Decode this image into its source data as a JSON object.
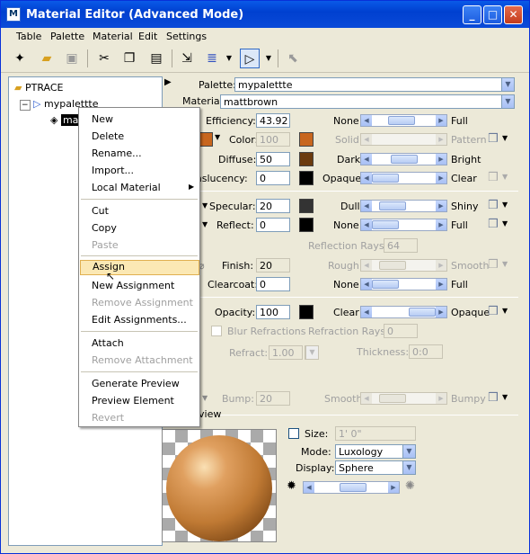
{
  "window": {
    "title": "Material Editor (Advanced Mode)",
    "controls": {
      "minimize": "_",
      "maximize": "□",
      "close": "✕"
    }
  },
  "menubar": [
    "Table",
    "Palette",
    "Material",
    "Edit",
    "Settings"
  ],
  "toolbar": {
    "icons": [
      "new-icon",
      "open-icon",
      "save-icon",
      "cut-icon",
      "copy-icon",
      "paste-icon",
      "import-icon",
      "palette-layers-icon",
      "assign-icon",
      "pick-icon"
    ]
  },
  "tree": {
    "root": "PTRACE",
    "palette": "mypalettte",
    "material": "ma"
  },
  "context_menu": {
    "items": [
      {
        "label": "New",
        "disabled": false
      },
      {
        "label": "Delete",
        "disabled": false
      },
      {
        "label": "Rename...",
        "disabled": false
      },
      {
        "label": "Import...",
        "disabled": false
      },
      {
        "label": "Local Material",
        "disabled": false,
        "submenu": true
      },
      {
        "label": "Cut",
        "disabled": false
      },
      {
        "label": "Copy",
        "disabled": false
      },
      {
        "label": "Paste",
        "disabled": true
      },
      {
        "label": "Assign",
        "disabled": false,
        "highlighted": true
      },
      {
        "label": "New Assignment",
        "disabled": false
      },
      {
        "label": "Remove Assignment",
        "disabled": true
      },
      {
        "label": "Edit Assignments...",
        "disabled": false
      },
      {
        "label": "Attach",
        "disabled": false
      },
      {
        "label": "Remove Attachment",
        "disabled": true
      },
      {
        "label": "Generate Preview",
        "disabled": false
      },
      {
        "label": "Preview Element",
        "disabled": false
      },
      {
        "label": "Revert",
        "disabled": true
      }
    ]
  },
  "editor": {
    "palette_label": "Palette:",
    "palette_value": "mypalettte",
    "material_label": "Material:",
    "material_value": "mattbrown",
    "efficiency": {
      "label": "Efficiency:",
      "value": "43.92",
      "min": "None",
      "max": "Full",
      "level": 0.44
    },
    "color": {
      "label": "Color:",
      "value": "100",
      "min": "Solid",
      "max": "Pattern",
      "swatch": "#c8661e",
      "sample": "#c8661e"
    },
    "diffuse": {
      "label": "Diffuse:",
      "value": "50",
      "min": "Dark",
      "max": "Bright",
      "swatch": "#6b3a0e",
      "level": 0.5
    },
    "translucency": {
      "label": "anslucency:",
      "value": "0",
      "min": "Opaque",
      "max": "Clear",
      "swatch": "#000000",
      "level": 0.0
    },
    "specular": {
      "label": "Specular:",
      "value": "20",
      "min": "Dull",
      "max": "Shiny",
      "swatch": "#333333",
      "level": 0.2
    },
    "reflect": {
      "label": "Reflect:",
      "value": "0",
      "min": "None",
      "max": "Full",
      "swatch": "#000000",
      "level": 0.0
    },
    "reflection_rays": {
      "label": "Reflection Rays:",
      "value": "64"
    },
    "finish": {
      "label": "Finish:",
      "value": "20",
      "min": "Rough",
      "max": "Smooth",
      "level": 0.2
    },
    "clearcoat": {
      "label": "Clearcoat:",
      "value": "0",
      "min": "None",
      "max": "Full",
      "level": 0.0
    },
    "opacity": {
      "label": "Opacity:",
      "value": "100",
      "min": "Clear",
      "max": "Opaque",
      "swatch": "#000000",
      "level": 1.0
    },
    "blur_refractions": "Blur Refractions",
    "refraction_rays": {
      "label": "Refraction Rays:",
      "value": "0"
    },
    "refract": {
      "label": "Refract:",
      "value": "1.00"
    },
    "thickness": {
      "label": "Thickness:",
      "value": "0:0"
    },
    "bump": {
      "label": "Bump:",
      "value": "20",
      "min": "Smooth",
      "max": "Bumpy",
      "level": 0.2
    },
    "preview_label": "view",
    "size": {
      "label": "Size:",
      "value": "1' 0\""
    },
    "mode": {
      "label": "Mode:",
      "value": "Luxology"
    },
    "display": {
      "label": "Display:",
      "value": "Sphere"
    }
  }
}
